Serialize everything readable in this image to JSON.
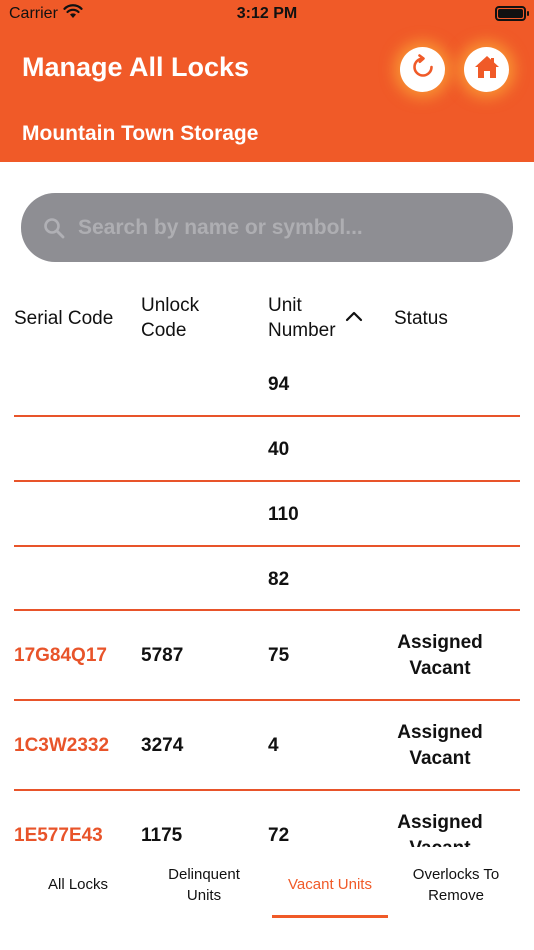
{
  "status_bar": {
    "carrier": "Carrier",
    "time": "3:12 PM"
  },
  "header": {
    "title": "Manage All Locks",
    "facility": "Mountain Town Storage",
    "background_color": "#f05a28",
    "refresh_icon": "refresh-icon",
    "home_icon": "home-icon"
  },
  "search": {
    "placeholder": "Search by name or symbol...",
    "value": ""
  },
  "table": {
    "columns": {
      "serial": "Serial Code",
      "unlock_line1": "Unlock",
      "unlock_line2": "Code",
      "unit_line1": "Unit",
      "unit_line2": "Number",
      "status": "Status"
    },
    "sort": {
      "column": "Unit Number",
      "direction": "ascending",
      "icon": "chevron-up-icon"
    },
    "rows": [
      {
        "serial": "",
        "code": "",
        "unit": "94",
        "status_line1": "",
        "status_line2": ""
      },
      {
        "serial": "",
        "code": "",
        "unit": "40",
        "status_line1": "",
        "status_line2": ""
      },
      {
        "serial": "",
        "code": "",
        "unit": "110",
        "status_line1": "",
        "status_line2": ""
      },
      {
        "serial": "",
        "code": "",
        "unit": "82",
        "status_line1": "",
        "status_line2": ""
      },
      {
        "serial": "17G84Q17",
        "code": "5787",
        "unit": "75",
        "status_line1": "Assigned",
        "status_line2": "Vacant"
      },
      {
        "serial": "1C3W2332",
        "code": "3274",
        "unit": "4",
        "status_line1": "Assigned",
        "status_line2": "Vacant"
      },
      {
        "serial": "1E577E43",
        "code": "1175",
        "unit": "72",
        "status_line1": "Assigned",
        "status_line2": "Vacant"
      }
    ]
  },
  "tabs": [
    {
      "label": "All Locks",
      "active": false
    },
    {
      "label": "Delinquent Units",
      "active": false
    },
    {
      "label": "Vacant Units",
      "active": true
    },
    {
      "label": "Overlocks To Remove",
      "active": false
    }
  ]
}
